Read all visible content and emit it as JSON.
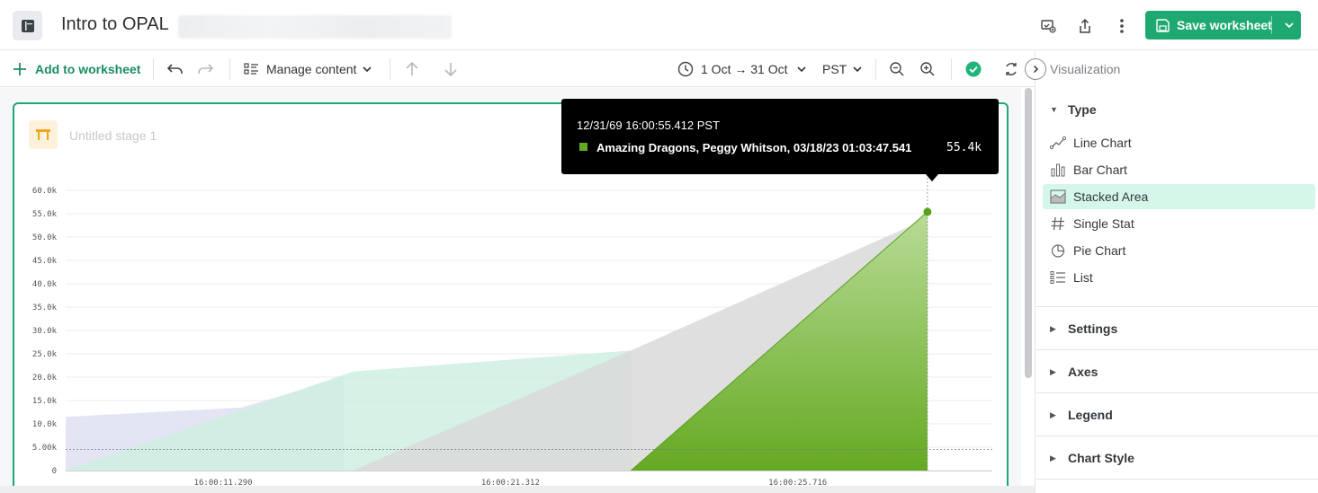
{
  "header": {
    "title": "Intro to OPAL",
    "save_label": "Save worksheet",
    "accent": "#1fa972"
  },
  "toolbar": {
    "add_label": "Add to worksheet",
    "manage_label": "Manage content",
    "time_range": "1 Oct → 31 Oct",
    "timezone": "PST"
  },
  "panel": {
    "title": "Visualization",
    "type_section": "Type",
    "types": [
      {
        "label": "Line Chart",
        "icon": "line-chart-icon"
      },
      {
        "label": "Bar Chart",
        "icon": "bar-chart-icon"
      },
      {
        "label": "Stacked Area",
        "icon": "stacked-area-icon",
        "selected": true
      },
      {
        "label": "Single Stat",
        "icon": "hash-icon"
      },
      {
        "label": "Pie Chart",
        "icon": "pie-chart-icon"
      },
      {
        "label": "List",
        "icon": "list-icon"
      }
    ],
    "sections": [
      "Settings",
      "Axes",
      "Legend",
      "Chart Style"
    ]
  },
  "stage": {
    "name": "Untitled stage 1"
  },
  "tooltip": {
    "time": "12/31/69 16:00:55.412 PST",
    "series": "Amazing Dragons, Peggy Whitson, 03/18/23 01:03:47.541",
    "value": "55.4k",
    "color": "#64a922"
  },
  "chart_data": {
    "type": "area",
    "stacked": true,
    "y_ticks": [
      "0",
      "5.00k",
      "10.0k",
      "15.0k",
      "20.0k",
      "25.0k",
      "30.0k",
      "35.0k",
      "40.0k",
      "45.0k",
      "50.0k",
      "55.0k",
      "60.0k"
    ],
    "ylim": [
      0,
      60000
    ],
    "x_ticks": [
      "16:00:11.290",
      "16:00:21.312",
      "16:00:25.716"
    ],
    "reference_line": 4500,
    "series": [
      {
        "color": "#dfe1f2",
        "points": [
          [
            0,
            11500
          ],
          [
            0.19,
            13500
          ],
          [
            0.3,
            20000
          ]
        ]
      },
      {
        "color": "#cfeee0",
        "points": [
          [
            0,
            0
          ],
          [
            0.31,
            21200
          ],
          [
            0.61,
            25700
          ]
        ]
      },
      {
        "color": "#d9d9d9",
        "points": [
          [
            0.31,
            0
          ],
          [
            0.61,
            25700
          ],
          [
            0.93,
            54000
          ]
        ]
      },
      {
        "color": "#64a922",
        "points": [
          [
            0.61,
            0
          ],
          [
            0.93,
            55400
          ]
        ]
      }
    ]
  }
}
